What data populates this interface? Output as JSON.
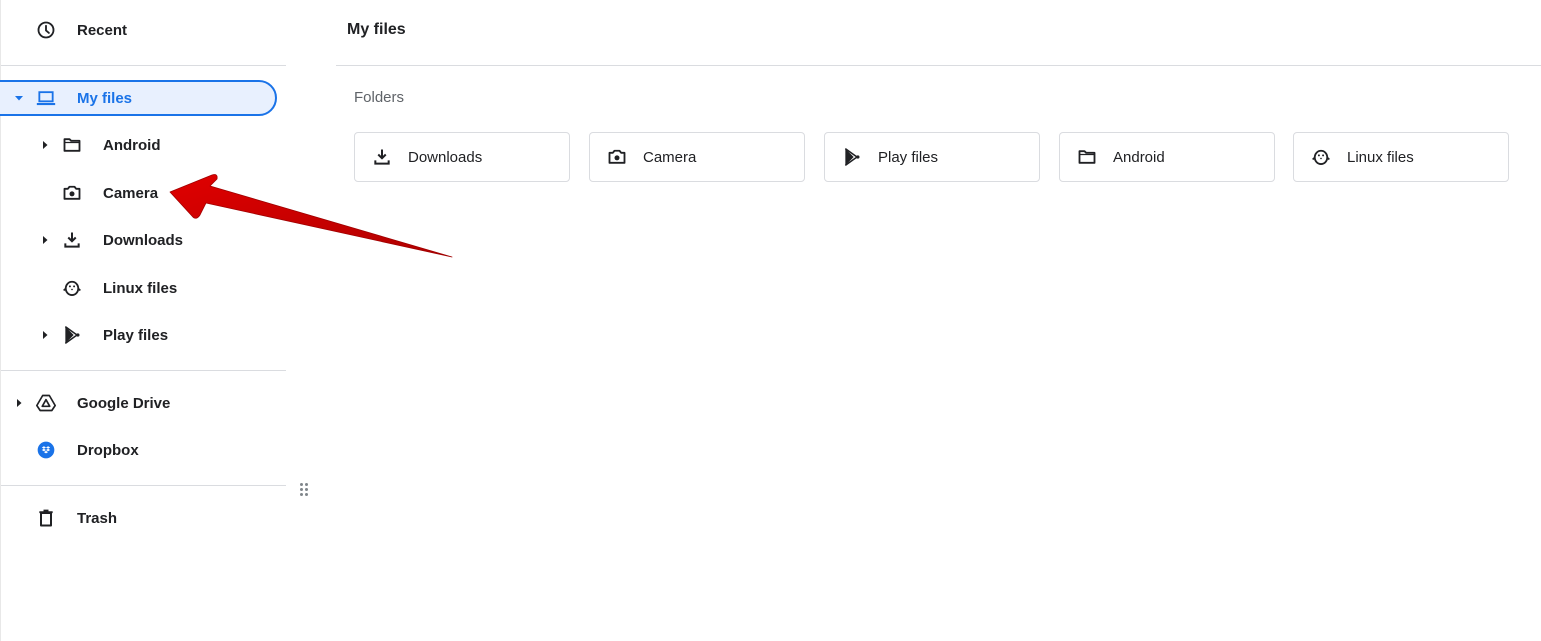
{
  "sidebar": {
    "recent": {
      "label": "Recent",
      "icon": "clock-icon"
    },
    "my_files": {
      "label": "My files",
      "icon": "laptop-icon",
      "expanded": true,
      "selected": true,
      "children": [
        {
          "label": "Android",
          "icon": "folder-icon",
          "expandable": true
        },
        {
          "label": "Camera",
          "icon": "camera-icon",
          "expandable": false
        },
        {
          "label": "Downloads",
          "icon": "download-icon",
          "expandable": true
        },
        {
          "label": "Linux files",
          "icon": "penguin-icon",
          "expandable": false
        },
        {
          "label": "Play files",
          "icon": "play-icon",
          "expandable": true
        }
      ]
    },
    "google_drive": {
      "label": "Google Drive",
      "icon": "google-drive-icon",
      "expandable": true
    },
    "dropbox": {
      "label": "Dropbox",
      "icon": "dropbox-icon"
    },
    "trash": {
      "label": "Trash",
      "icon": "trash-icon"
    }
  },
  "main": {
    "title": "My files",
    "section_label": "Folders",
    "folders": [
      {
        "label": "Downloads",
        "icon": "download-icon"
      },
      {
        "label": "Camera",
        "icon": "camera-icon"
      },
      {
        "label": "Play files",
        "icon": "play-icon"
      },
      {
        "label": "Android",
        "icon": "folder-icon"
      },
      {
        "label": "Linux files",
        "icon": "penguin-icon"
      }
    ]
  },
  "colors": {
    "accent": "#1a73e8",
    "selected_bg": "#e8f0fe",
    "text": "#202124",
    "secondary_text": "#5f6368",
    "divider": "#dadce0",
    "annotation_arrow": "#d40000",
    "dropbox_blue": "#1a73e8"
  },
  "annotation": {
    "type": "arrow",
    "points_to": "Camera"
  }
}
